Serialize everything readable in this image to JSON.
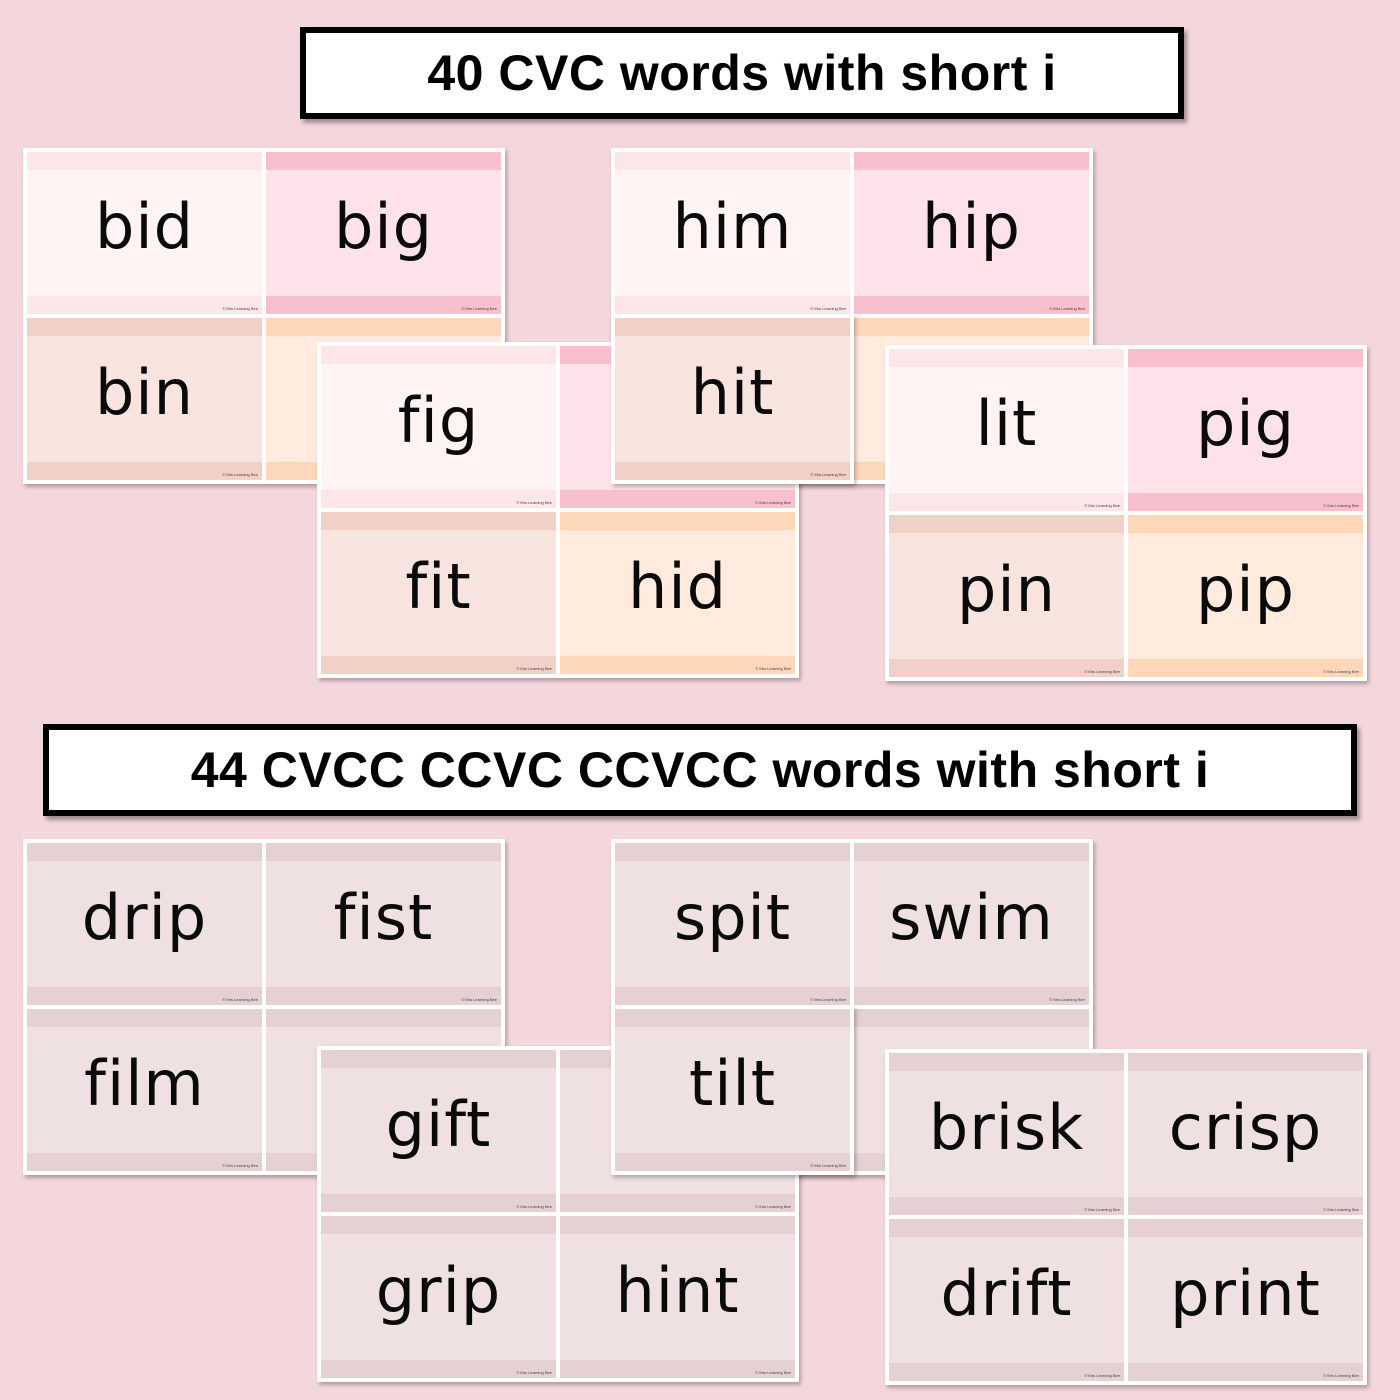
{
  "banners": {
    "cvc": "40 CVC words with short i",
    "blends": "44 CVCC CCVC CCVCC words with short i"
  },
  "credit": "© Mrs Learning Bee",
  "sheets": [
    {
      "words": [
        "bid",
        "big",
        "bin",
        ""
      ]
    },
    {
      "words": [
        "him",
        "hip",
        "hit",
        ""
      ]
    },
    {
      "words": [
        "fig",
        "",
        "fit",
        "hid"
      ]
    },
    {
      "words": [
        "lit",
        "pig",
        "pin",
        "pip"
      ]
    },
    {
      "words": [
        "drip",
        "fist",
        "film",
        ""
      ]
    },
    {
      "words": [
        "spit",
        "swim",
        "tilt",
        ""
      ]
    },
    {
      "words": [
        "gift",
        "",
        "grip",
        "hint"
      ]
    },
    {
      "words": [
        "brisk",
        "crisp",
        "drift",
        "print"
      ]
    }
  ],
  "colors": {
    "background": "#f4d7dd",
    "blush": "#fff3f3",
    "pink": "#fde3e9",
    "nude": "#f8e4df",
    "peach": "#ffebde",
    "mauve": "#efe1e2"
  }
}
